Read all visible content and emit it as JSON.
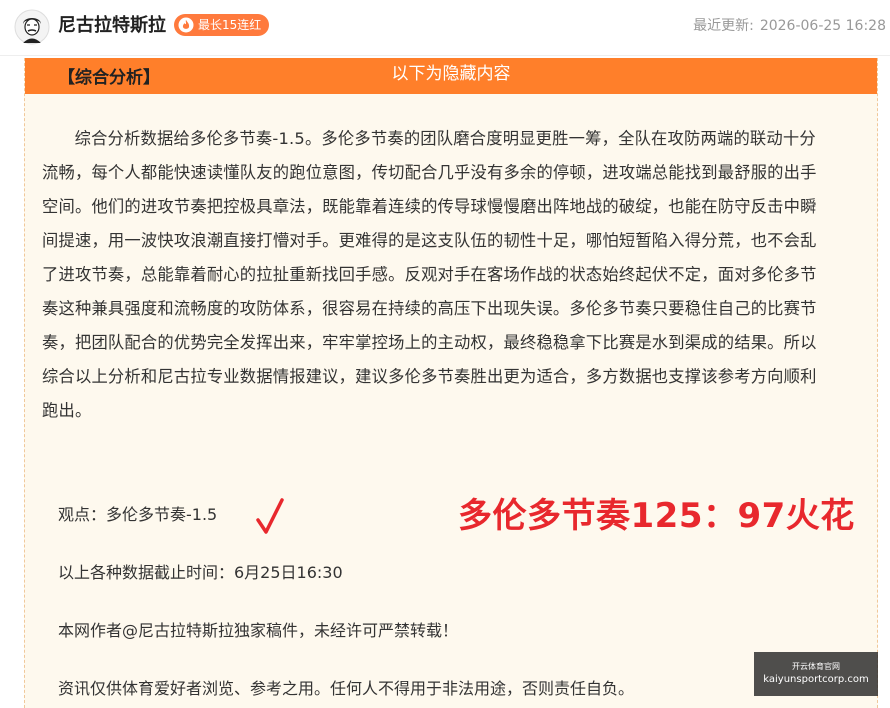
{
  "header": {
    "author_name": "尼古拉特斯拉",
    "streak_badge": "最长15连红",
    "update_label": "最近更新:",
    "update_time": "2026-06-25 16:28"
  },
  "hidden_banner": "以下为隐藏内容",
  "article": {
    "section_title": "【综合分析】",
    "analysis": "综合分析数据给多伦多节奏-1.5。多伦多节奏的团队磨合度明显更胜一筹，全队在攻防两端的联动十分流畅，每个人都能快速读懂队友的跑位意图，传切配合几乎没有多余的停顿，进攻端总能找到最舒服的出手空间。他们的进攻节奏把控极具章法，既能靠着连续的传导球慢慢磨出阵地战的破绽，也能在防守反击中瞬间提速，用一波快攻浪潮直接打懵对手。更难得的是这支队伍的韧性十足，哪怕短暂陷入得分荒，也不会乱了进攻节奏，总能靠着耐心的拉扯重新找回手感。反观对手在客场作战的状态始终起伏不定，面对多伦多节奏这种兼具强度和流畅度的攻防体系，很容易在持续的高压下出现失误。多伦多节奏只要稳住自己的比赛节奏，把团队配合的优势完全发挥出来，牢牢掌控场上的主动权，最终稳稳拿下比赛是水到渠成的结果。所以综合以上分析和尼古拉专业数据情报建议，建议多伦多节奏胜出更为适合，多方数据也支撑该参考方向顺利跑出。",
    "viewpoint": "观点：多伦多节奏-1.5",
    "result": "多伦多节奏125：97火花",
    "cutoff": "以上各种数据截止时间：6月25日16:30",
    "copyright": "本网作者@尼古拉特斯拉独家稿件，未经许可严禁转载！",
    "disclaimer": "资讯仅供体育爱好者浏览、参考之用。任何人不得用于非法用途，否则责任自负。"
  },
  "watermark": {
    "top": "开云体育官网",
    "site": "kaiyunsportcorp.com"
  },
  "colors": {
    "accent": "#ff7f2a",
    "badge": "#ff7a3d",
    "result_red": "#e8282d",
    "panel_bg": "#fef9ee"
  },
  "icons": [
    "avatar",
    "flame-icon",
    "checkmark-icon"
  ]
}
